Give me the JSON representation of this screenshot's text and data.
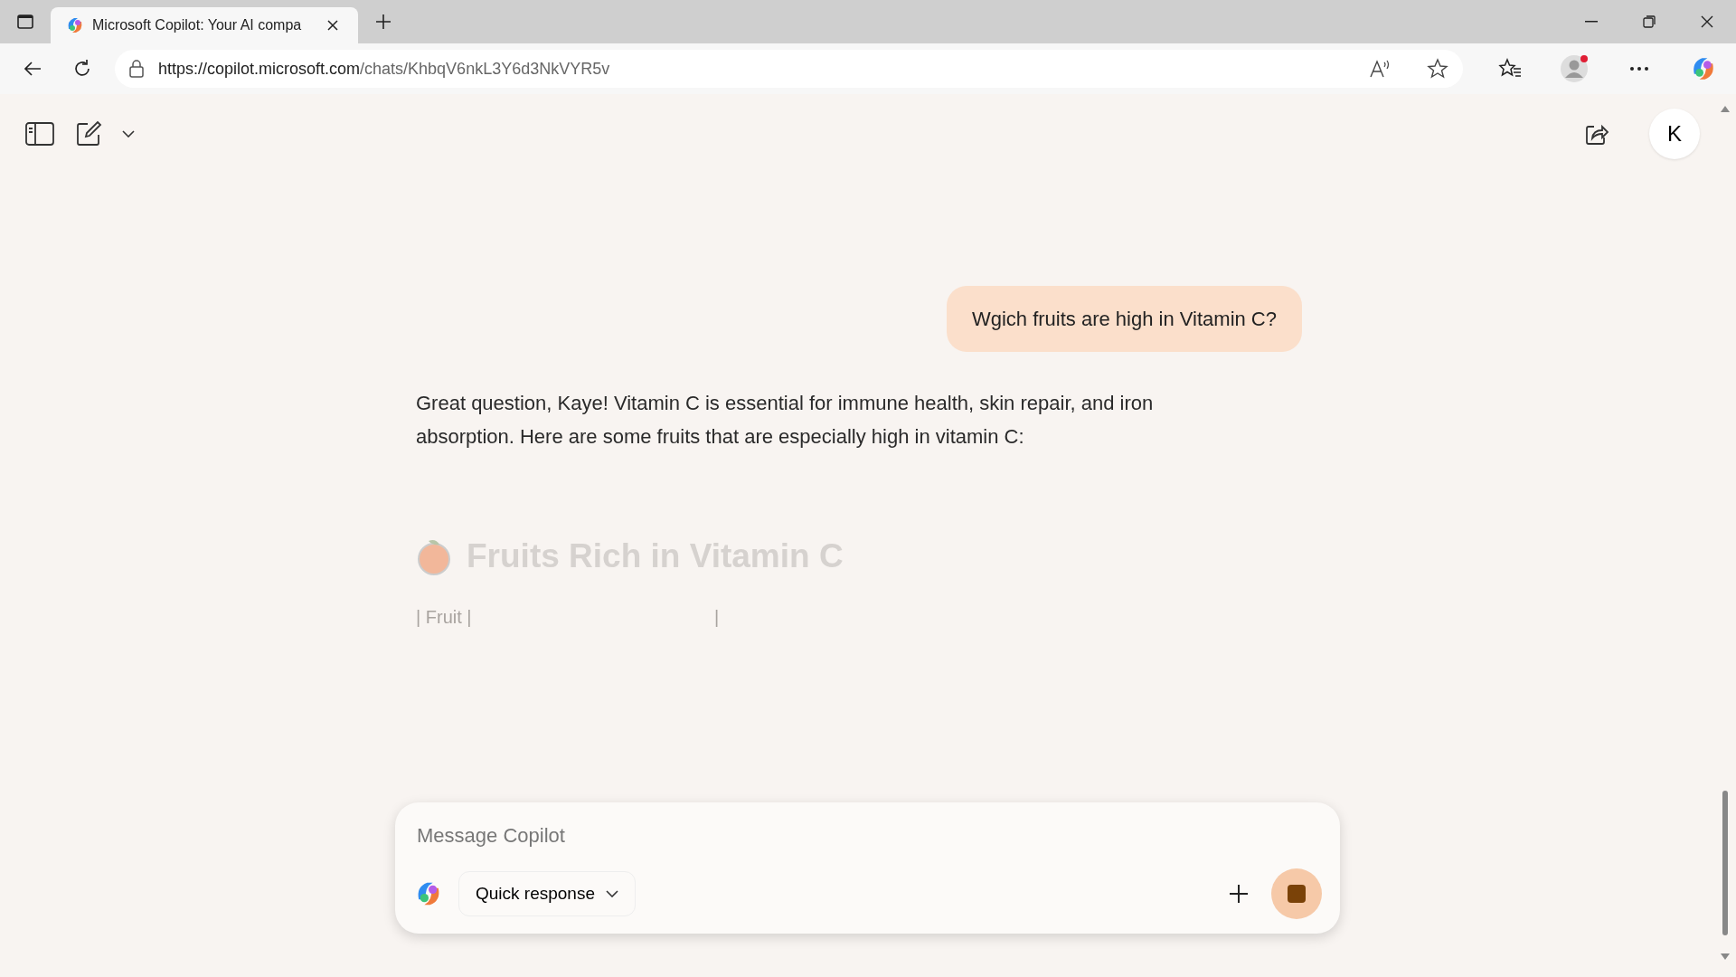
{
  "browser": {
    "tab_title": "Microsoft Copilot: Your AI compa",
    "url_host": "https://copilot.microsoft.com",
    "url_path": "/chats/KhbqV6nkL3Y6d3NkVYR5v"
  },
  "header": {
    "avatar_letter": "K"
  },
  "messages": [
    {
      "kind": "user",
      "text": "Wgich fruits are high in Vitamin C?"
    },
    {
      "kind": "assistant",
      "text": "Great question, Kaye! Vitamin C is essential for immune health, skin repair, and iron absorption. Here are some fruits that are especially high in vitamin C:",
      "heading": "Fruits Rich in Vitamin C",
      "table_row": [
        "| Fruit |",
        "|"
      ]
    }
  ],
  "composer": {
    "placeholder": "Message Copilot",
    "mode": "Quick response"
  }
}
